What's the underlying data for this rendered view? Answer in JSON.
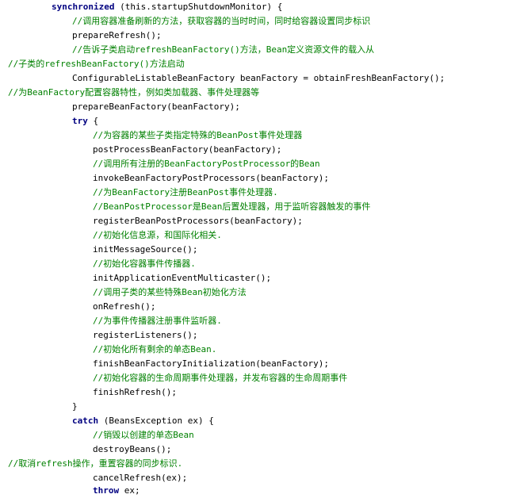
{
  "code": {
    "lines": [
      {
        "kind": "kw",
        "text": "synchronized",
        "rest": " (this.startupShutdownMonitor) {"
      },
      {
        "kind": "cm",
        "text": "//调用容器准备刷新的方法，获取容器的当时时间，同时给容器设置同步标识"
      },
      {
        "kind": "tx",
        "text": "prepareRefresh();"
      },
      {
        "kind": "cm",
        "text": "//告诉子类启动refreshBeanFactory()方法，Bean定义资源文件的载入从"
      },
      {
        "kind": "cm",
        "text": "//子类的refreshBeanFactory()方法启动"
      },
      {
        "kind": "tx",
        "text": "ConfigurableListableBeanFactory beanFactory = obtainFreshBeanFactory();"
      },
      {
        "kind": "cm",
        "text": "//为BeanFactory配置容器特性，例如类加载器、事件处理器等"
      },
      {
        "kind": "tx",
        "text": "prepareBeanFactory(beanFactory);"
      },
      {
        "kind": "kw",
        "text": "try",
        "rest": " {"
      },
      {
        "kind": "cm",
        "text": "//为容器的某些子类指定特殊的BeanPost事件处理器"
      },
      {
        "kind": "tx",
        "text": "postProcessBeanFactory(beanFactory);"
      },
      {
        "kind": "cm",
        "text": "//调用所有注册的BeanFactoryPostProcessor的Bean"
      },
      {
        "kind": "tx",
        "text": "invokeBeanFactoryPostProcessors(beanFactory);"
      },
      {
        "kind": "cm",
        "text": "//为BeanFactory注册BeanPost事件处理器."
      },
      {
        "kind": "cm",
        "text": "//BeanPostProcessor是Bean后置处理器，用于监听容器触发的事件"
      },
      {
        "kind": "tx",
        "text": "registerBeanPostProcessors(beanFactory);"
      },
      {
        "kind": "cm",
        "text": "//初始化信息源，和国际化相关."
      },
      {
        "kind": "tx",
        "text": "initMessageSource();"
      },
      {
        "kind": "cm",
        "text": "//初始化容器事件传播器."
      },
      {
        "kind": "tx",
        "text": "initApplicationEventMulticaster();"
      },
      {
        "kind": "cm",
        "text": "//调用子类的某些特殊Bean初始化方法"
      },
      {
        "kind": "tx",
        "text": "onRefresh();"
      },
      {
        "kind": "cm",
        "text": "//为事件传播器注册事件监听器."
      },
      {
        "kind": "tx",
        "text": "registerListeners();"
      },
      {
        "kind": "cm",
        "text": "//初始化所有剩余的单态Bean."
      },
      {
        "kind": "tx",
        "text": "finishBeanFactoryInitialization(beanFactory);"
      },
      {
        "kind": "cm",
        "text": "//初始化容器的生命周期事件处理器，并发布容器的生命周期事件"
      },
      {
        "kind": "tx",
        "text": "finishRefresh();"
      },
      {
        "kind": "tx",
        "text": "}"
      },
      {
        "kind": "kw",
        "text": "catch",
        "rest": " (BeansException ex) {"
      },
      {
        "kind": "cm",
        "text": "//销毁以创建的单态Bean"
      },
      {
        "kind": "tx",
        "text": "destroyBeans();"
      },
      {
        "kind": "cm",
        "text": "//取消refresh操作，重置容器的同步标识."
      },
      {
        "kind": "tx",
        "text": "cancelRefresh(ex);"
      },
      {
        "kind": "kw",
        "text": "throw",
        "rest": " ex;"
      }
    ]
  }
}
